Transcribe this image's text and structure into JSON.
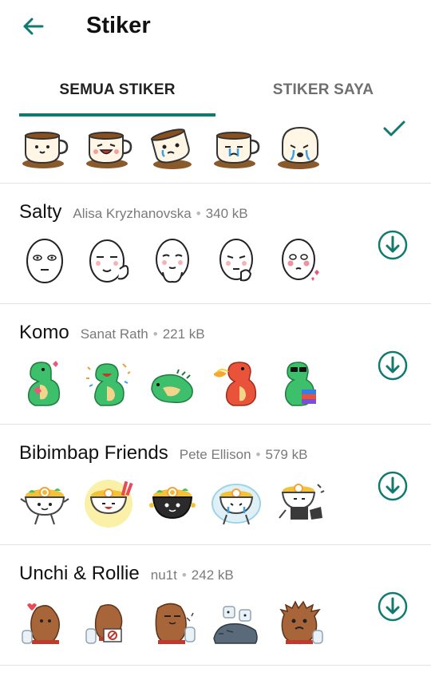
{
  "header": {
    "title": "Stiker",
    "back_icon": "arrow-left-icon"
  },
  "tabs": [
    {
      "label": "SEMUA STIKER",
      "active": true
    },
    {
      "label": "STIKER SAYA",
      "active": false
    }
  ],
  "colors": {
    "accent": "#117a6e"
  },
  "installed_pack": {
    "sticker_count": 5,
    "status_icon": "check-icon"
  },
  "packs": [
    {
      "name": "Salty",
      "author": "Alisa Kryzhanovska",
      "separator": "•",
      "size": "340 kB",
      "download_icon": "download-icon"
    },
    {
      "name": "Komo",
      "author": "Sanat Rath",
      "separator": "•",
      "size": "221 kB",
      "download_icon": "download-icon"
    },
    {
      "name": "Bibimbap Friends",
      "author": "Pete Ellison",
      "separator": "•",
      "size": "579 kB",
      "download_icon": "download-icon"
    },
    {
      "name": "Unchi & Rollie",
      "author": "nu1t",
      "separator": "•",
      "size": "242 kB",
      "download_icon": "download-icon"
    }
  ]
}
